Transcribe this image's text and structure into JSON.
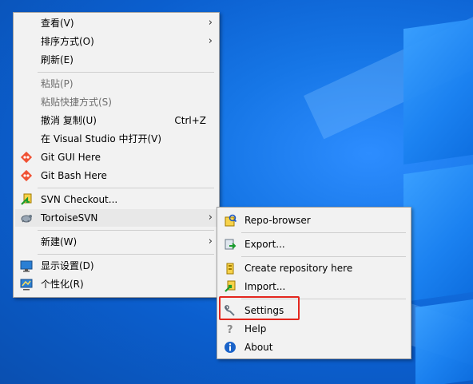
{
  "main_menu": {
    "items": [
      {
        "label": "查看(V)",
        "submenu": true
      },
      {
        "label": "排序方式(O)",
        "submenu": true
      },
      {
        "label": "刷新(E)"
      },
      {
        "label": "粘贴(P)",
        "disabled": true
      },
      {
        "label": "粘贴快捷方式(S)",
        "disabled": true
      },
      {
        "label": "撤消 复制(U)",
        "shortcut": "Ctrl+Z"
      },
      {
        "label": "在 Visual Studio 中打开(V)"
      },
      {
        "label": "Git GUI Here",
        "icon": "git-icon"
      },
      {
        "label": "Git Bash Here",
        "icon": "git-icon"
      },
      {
        "label": "SVN Checkout...",
        "icon": "svn-checkout-icon"
      },
      {
        "label": "TortoiseSVN",
        "icon": "tortoisesvn-icon",
        "submenu": true
      },
      {
        "label": "新建(W)",
        "submenu": true
      },
      {
        "label": "显示设置(D)",
        "icon": "display-icon"
      },
      {
        "label": "个性化(R)",
        "icon": "personalize-icon"
      }
    ]
  },
  "tortoise_menu": {
    "items": [
      {
        "label": "Repo-browser",
        "icon": "repo-browser-icon"
      },
      {
        "label": "Export...",
        "icon": "export-icon"
      },
      {
        "label": "Create repository here",
        "icon": "create-repo-icon"
      },
      {
        "label": "Import...",
        "icon": "import-icon"
      },
      {
        "label": "Settings",
        "icon": "settings-icon"
      },
      {
        "label": "Help",
        "icon": "help-icon"
      },
      {
        "label": "About",
        "icon": "about-icon"
      }
    ]
  },
  "colors": {
    "highlight": "#e3271e",
    "menu_bg": "#f2f2f2"
  }
}
